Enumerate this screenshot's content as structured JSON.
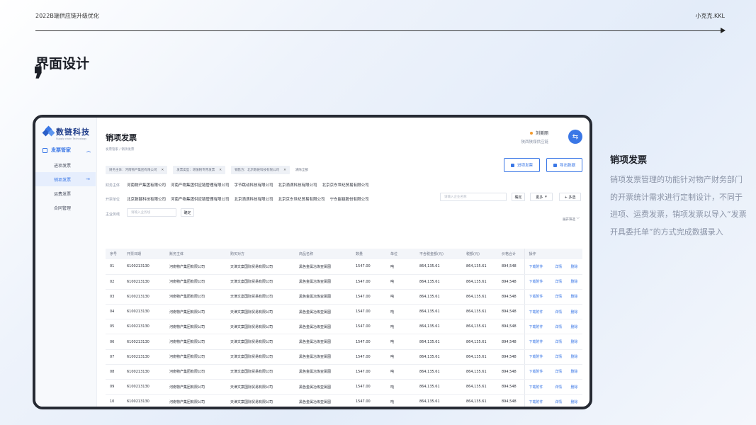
{
  "page": {
    "header_title": "2022B端供应链升级优化",
    "author": "小克克.KKL",
    "section_title": "界面设计",
    "quote_mark": "❜"
  },
  "app": {
    "logo_name": "数链科技",
    "logo_sub": "Supply chain Technology",
    "nav_group": "发票管家",
    "nav_items": [
      "进项发票",
      "销项发票",
      "运费发票",
      "合同管理"
    ],
    "active_nav": 1,
    "page_title": "销项发票",
    "breadcrumb": "发票管家 / 销项发票",
    "user_name": "刘美丽",
    "user_company": "陕西陕煤供应链",
    "chips": [
      "财务主体：河南物产集团有限公司",
      "发票类型：增值税专用发票",
      "销售方：北京数链科技有限公司"
    ],
    "clear_label": "清除全部",
    "import_button": "进项发票",
    "export_button": "导出数据",
    "filter_rows": [
      {
        "label": "财务主体",
        "options": [
          "河南物产集团有限公司",
          "河南产物集团供应链管理有限公司",
          "字节跳动科技有限公司",
          "北京滴滴科技有限公司",
          "北京京东世纪贸易有限公司"
        ]
      },
      {
        "label": "开票单位",
        "options": [
          "北京数链科技有限公司",
          "河南产物集团供应链管理有限公司",
          "北京滴滴科技有限公司",
          "北京京东世纪贸易有限公司",
          "宁东能链股份有限公司"
        ]
      }
    ],
    "company_search_placeholder": "请输入企业名称",
    "confirm_label": "确定",
    "more_label": "更多",
    "multi_label": "+ 多选",
    "entity_label": "主业务线",
    "entity_placeholder": "请输入业务线",
    "expand_label": "展开筛选",
    "table": {
      "headers": [
        "序号",
        "开票日期",
        "账务主体",
        "购买对方",
        "商品名称",
        "数量",
        "单位",
        "不含税金额(元)",
        "税额(元)",
        "价格合计",
        "操作"
      ],
      "rows": [
        [
          "01",
          "6100213130",
          "河南物产集团有限公司",
          "天津文案国际贸易有限公司",
          "黑色金属冶炼亚氯图",
          "1547.00",
          "吨",
          "864,135.61",
          "864,135.61",
          "894,548"
        ],
        [
          "02",
          "6100213130",
          "河南物产集团有限公司",
          "天津文案国际贸易有限公司",
          "黑色金属冶炼亚氯图",
          "1547.00",
          "吨",
          "864,135.61",
          "864,135.61",
          "894,548"
        ],
        [
          "03",
          "6100213130",
          "河南物产集团有限公司",
          "天津文案国际贸易有限公司",
          "黑色金属冶炼亚氯图",
          "1547.00",
          "吨",
          "864,135.61",
          "864,135.61",
          "894,548"
        ],
        [
          "04",
          "6100213130",
          "河南物产集团有限公司",
          "天津文案国际贸易有限公司",
          "黑色金属冶炼亚氯图",
          "1547.00",
          "吨",
          "864,135.61",
          "864,135.61",
          "894,548"
        ],
        [
          "05",
          "6100213130",
          "河南物产集团有限公司",
          "天津文案国际贸易有限公司",
          "黑色金属冶炼亚氯图",
          "1547.00",
          "吨",
          "864,135.61",
          "864,135.61",
          "894,548"
        ],
        [
          "06",
          "6100213130",
          "河南物产集团有限公司",
          "天津文案国际贸易有限公司",
          "黑色金属冶炼亚氯图",
          "1547.00",
          "吨",
          "864,135.61",
          "864,135.61",
          "894,548"
        ],
        [
          "07",
          "6100213130",
          "河南物产集团有限公司",
          "天津文案国际贸易有限公司",
          "黑色金属冶炼亚氯图",
          "1547.00",
          "吨",
          "864,135.61",
          "864,135.61",
          "894,548"
        ],
        [
          "08",
          "6100213130",
          "河南物产集团有限公司",
          "天津文案国际贸易有限公司",
          "黑色金属冶炼亚氯图",
          "1547.00",
          "吨",
          "864,135.61",
          "864,135.61",
          "894,548"
        ],
        [
          "09",
          "6100213130",
          "河南物产集团有限公司",
          "天津文案国际贸易有限公司",
          "黑色金属冶炼亚氯图",
          "1547.00",
          "吨",
          "864,135.61",
          "864,135.61",
          "894,548"
        ],
        [
          "10",
          "6100213130",
          "河南物产集团有限公司",
          "天津文案国际贸易有限公司",
          "黑色金属冶炼亚氯图",
          "1547.00",
          "吨",
          "864,135.61",
          "864,135.61",
          "894,548"
        ]
      ],
      "actions": [
        "下载附件",
        "详情",
        "删除"
      ]
    }
  },
  "right_panel": {
    "title": "销项发票",
    "description": "销项发票管理的功能针对物产财务部门的开票统计需求进行定制设计，不同于进项、运费发票，销项发票以导入“发票开具委托单”的方式完成数据录入"
  },
  "colors": {
    "accent": "#3a77e6",
    "user_dot": "#f39a2b"
  }
}
